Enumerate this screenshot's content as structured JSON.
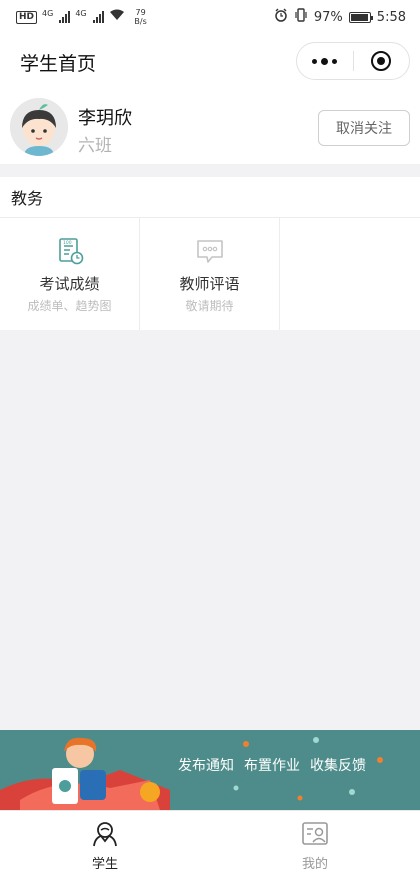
{
  "status_bar": {
    "hd_badge": "HD",
    "signal_tag": "4G",
    "speed_value": "79",
    "speed_unit": "B/s",
    "battery_percent": "97%",
    "battery_level": 0.97,
    "time": "5:58"
  },
  "nav": {
    "title": "学生首页"
  },
  "profile": {
    "name": "李玥欣",
    "class": "六班",
    "unfollow_label": "取消关注"
  },
  "affairs": {
    "section_title": "教务",
    "items": [
      {
        "label": "考试成绩",
        "sub": "成绩单、趋势图",
        "icon": "score-report-icon"
      },
      {
        "label": "教师评语",
        "sub": "敬请期待",
        "icon": "comment-bubble-icon"
      }
    ]
  },
  "banner": {
    "items": [
      "发布通知",
      "布置作业",
      "收集反馈"
    ]
  },
  "tab_bar": {
    "tabs": [
      {
        "label": "学生",
        "icon": "student-icon",
        "active": true
      },
      {
        "label": "我的",
        "icon": "profile-card-icon",
        "active": false
      }
    ]
  },
  "colors": {
    "accent_teal": "#4d9e9a",
    "banner_bg": "#4d8c8a",
    "page_bg": "#f2f2f4"
  }
}
